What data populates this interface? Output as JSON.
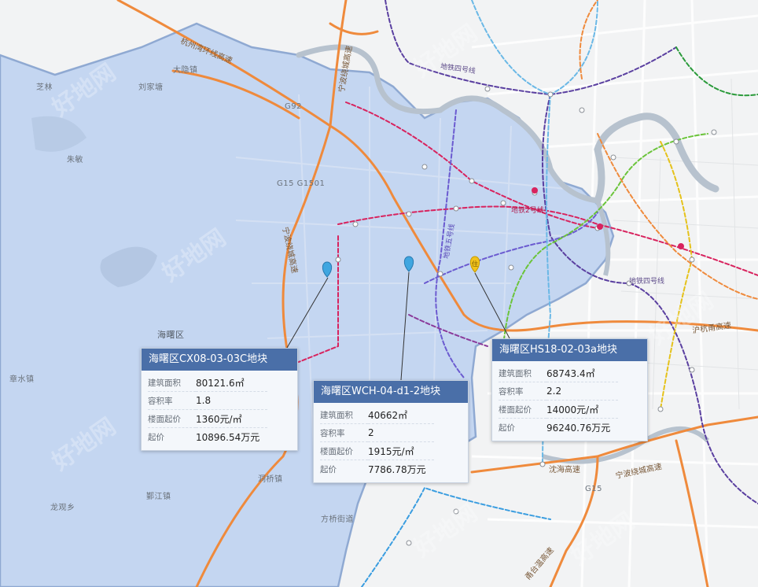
{
  "map": {
    "place_labels": [
      {
        "text": "芝林",
        "name": "label-zhilin"
      },
      {
        "text": "刘家塘",
        "name": "label-liujiatang"
      },
      {
        "text": "大隐镇",
        "name": "label-dayin"
      },
      {
        "text": "朱敏",
        "name": "label-zhumin"
      },
      {
        "text": "海曙区",
        "name": "label-haishu"
      },
      {
        "text": "章水镇",
        "name": "label-zhangshui"
      },
      {
        "text": "洞桥镇",
        "name": "label-dongqiao"
      },
      {
        "text": "鄞江镇",
        "name": "label-yinjiang"
      },
      {
        "text": "龙观乡",
        "name": "label-longguan"
      },
      {
        "text": "方桥街道",
        "name": "label-fangqiao"
      }
    ],
    "road_labels": [
      {
        "text": "杭州湾环线高速",
        "name": "road-hangzhouwan"
      },
      {
        "text": "宁波绕城高速",
        "name": "road-ring-north"
      },
      {
        "text": "G15 G1501",
        "name": "road-g15-g1501"
      },
      {
        "text": "G92",
        "name": "road-g92"
      },
      {
        "text": "沪杭甬高速",
        "name": "road-huhangyong"
      },
      {
        "text": "宁波绕城高速",
        "name": "road-ring-south"
      },
      {
        "text": "沈海高速",
        "name": "road-shenhai"
      },
      {
        "text": "G15",
        "name": "road-g15"
      },
      {
        "text": "甬台温高速",
        "name": "road-yongtaiwen"
      },
      {
        "text": "宁波绕城高速",
        "name": "road-ring-west"
      }
    ],
    "metro_labels": [
      {
        "text": "地铁四号线",
        "name": "metro-line4-label"
      },
      {
        "text": "地铁2号线",
        "name": "metro-line2-label"
      },
      {
        "text": "地铁四号线",
        "name": "metro-line4-label-2"
      },
      {
        "text": "地铁五号线",
        "name": "metro-line5-label"
      }
    ],
    "watermark": "好地网",
    "pins": [
      {
        "name": "pin-cx08",
        "color": "#3fa6e0",
        "badge": ""
      },
      {
        "name": "pin-wch04",
        "color": "#3fa6e0",
        "badge": ""
      },
      {
        "name": "pin-hs18",
        "color": "#f2c31b",
        "badge": "住"
      }
    ]
  },
  "parcels": [
    {
      "title": "海曙区CX08-03-03C地块",
      "rows": [
        {
          "k": "建筑面积",
          "v": "80121.6㎡"
        },
        {
          "k": "容积率",
          "v": "1.8"
        },
        {
          "k": "楼面起价",
          "v": "1360元/㎡"
        },
        {
          "k": "起价",
          "v": "10896.54万元"
        }
      ]
    },
    {
      "title": "海曙区WCH-04-d1-2地块",
      "rows": [
        {
          "k": "建筑面积",
          "v": "40662㎡"
        },
        {
          "k": "容积率",
          "v": "2"
        },
        {
          "k": "楼面起价",
          "v": "1915元/㎡"
        },
        {
          "k": "起价",
          "v": "7786.78万元"
        }
      ]
    },
    {
      "title": "海曙区HS18-02-03a地块",
      "rows": [
        {
          "k": "建筑面积",
          "v": "68743.4㎡"
        },
        {
          "k": "容积率",
          "v": "2.2"
        },
        {
          "k": "楼面起价",
          "v": "14000元/㎡"
        },
        {
          "k": "起价",
          "v": "96240.76万元"
        }
      ]
    }
  ],
  "colors": {
    "district_fill": "#c4d6f1",
    "district_border": "#8fa9d2",
    "highway": "#ef8a3c",
    "river": "#b7c2ce",
    "card_header": "#4a6fa8"
  }
}
